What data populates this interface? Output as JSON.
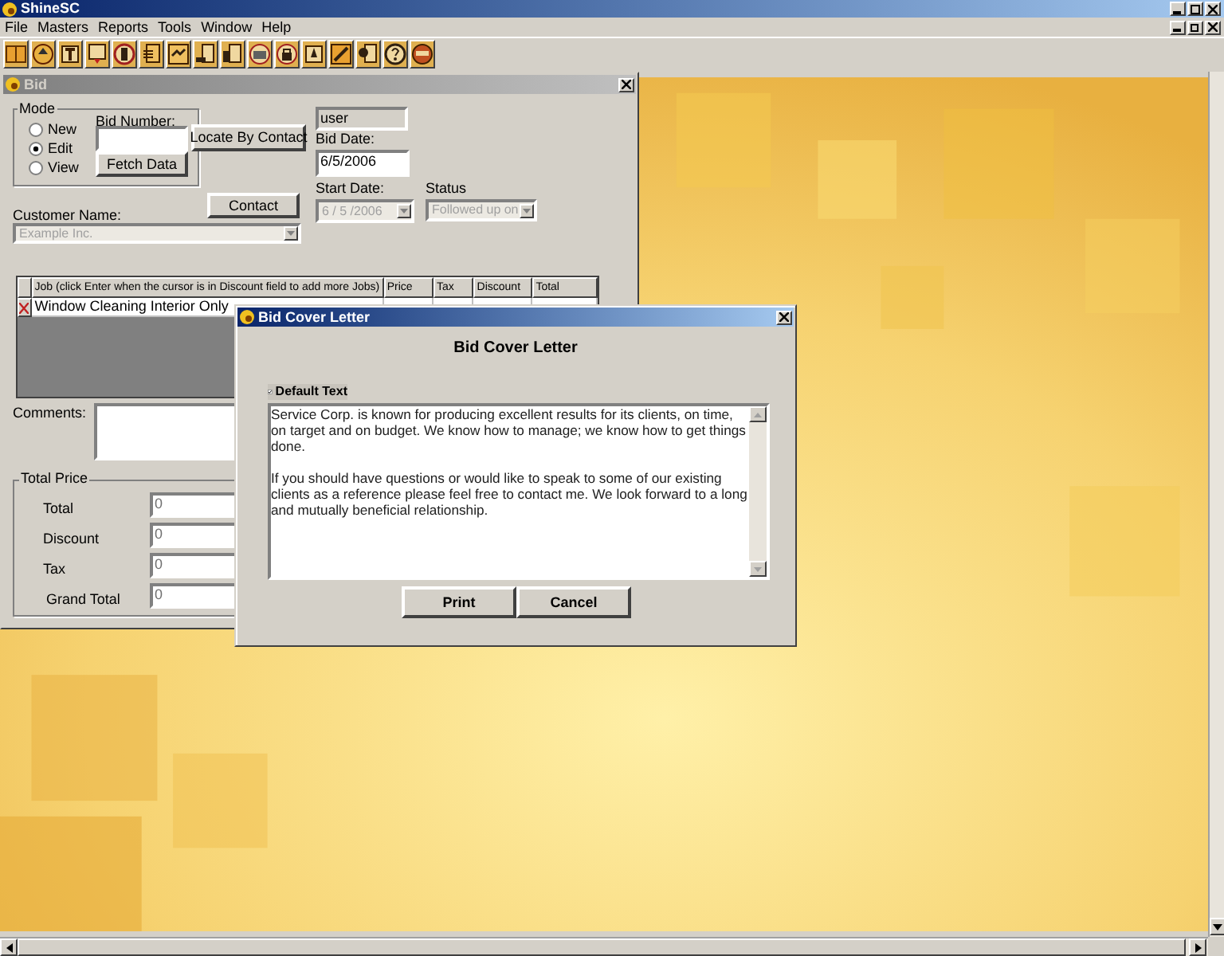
{
  "app": {
    "title": "ShineSC"
  },
  "menu": [
    "File",
    "Masters",
    "Reports",
    "Tools",
    "Window",
    "Help"
  ],
  "bid_window": {
    "title": "Bid",
    "mode": {
      "label": "Mode",
      "options": [
        {
          "label": "New",
          "selected": false
        },
        {
          "label": "Edit",
          "selected": true
        },
        {
          "label": "View",
          "selected": false
        }
      ]
    },
    "bid_number": {
      "label": "Bid Number:"
    },
    "locate_button": "Locate By Contact",
    "fetch_button": "Fetch Data",
    "user_field": {
      "value": "user"
    },
    "bid_date": {
      "label": "Bid Date:",
      "value": "6/5/2006"
    },
    "start_date": {
      "label": "Start Date:",
      "value": "6 / 5 /2006",
      "disabled": true
    },
    "status": {
      "label": "Status",
      "value": "Followed up on",
      "disabled": true
    },
    "customer": {
      "label": "Customer Name:",
      "value": "Example Inc.",
      "disabled": true
    },
    "contact_button": "Contact",
    "jobs": {
      "columns": [
        "Job (click Enter when the cursor is in Discount field to add more Jobs)",
        "Price",
        "Tax",
        "Discount",
        "Total"
      ],
      "rows": [
        {
          "job": "Window Cleaning Interior Only"
        }
      ]
    },
    "comments": {
      "label": "Comments:"
    },
    "total_price": {
      "label": "Total Price",
      "fields": [
        {
          "label": "Total",
          "value": "0"
        },
        {
          "label": "Discount",
          "value": "0"
        },
        {
          "label": "Tax",
          "value": "0"
        },
        {
          "label": "Grand Total",
          "value": "0"
        }
      ]
    }
  },
  "cover_letter": {
    "title": "Bid Cover Letter",
    "heading": "Bid Cover Letter",
    "default_text": {
      "label": "Default Text",
      "checked": true
    },
    "letter": [
      "Service Corp. is known for producing excellent results for its clients, on time, on target and on budget. We know how to manage; we know how to get things done.",
      "If you should have questions or would like to speak to some of our existing clients as a reference please feel free to contact me. We look forward to a long and mutually beneficial relationship."
    ],
    "buttons": [
      "Print",
      "Cancel"
    ]
  }
}
